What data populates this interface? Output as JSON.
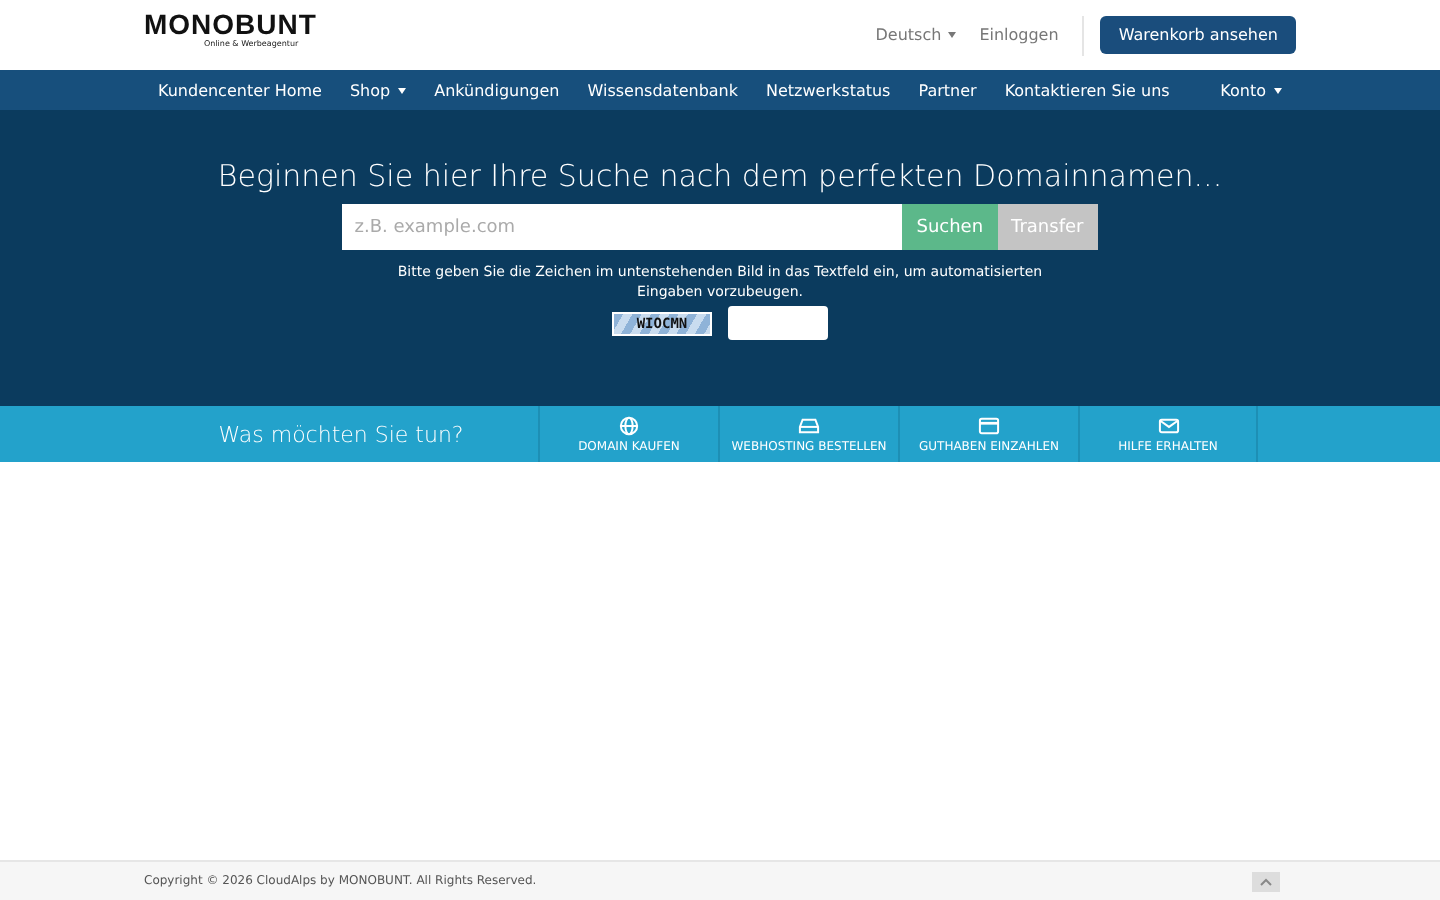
{
  "logo": {
    "name": "MONOBUNT",
    "tagline": "Online & Werbeagentur"
  },
  "top_links": [
    {
      "label": "Deutsch",
      "dropdown": true
    },
    {
      "label": "Einloggen",
      "dropdown": false
    }
  ],
  "cart_button": "Warenkorb ansehen",
  "nav": {
    "items": [
      {
        "label": "Kundencenter Home",
        "dropdown": false
      },
      {
        "label": "Shop",
        "dropdown": true
      },
      {
        "label": "Ankündigungen",
        "dropdown": false
      },
      {
        "label": "Wissensdatenbank",
        "dropdown": false
      },
      {
        "label": "Netzwerkstatus",
        "dropdown": false
      },
      {
        "label": "Partner",
        "dropdown": false
      },
      {
        "label": "Kontaktieren Sie uns",
        "dropdown": false
      }
    ],
    "account": {
      "label": "Konto",
      "dropdown": true
    }
  },
  "hero": {
    "title": "Beginnen Sie hier Ihre Suche nach dem perfekten Domainnamen...",
    "placeholder": "z.B. example.com",
    "search_button": "Suchen",
    "transfer_button": "Transfer",
    "captcha_hint": "Bitte geben Sie die Zeichen im untenstehenden Bild in das Textfeld ein, um automatisierten Eingaben vorzubeugen.",
    "captcha_code": "WIOCMN"
  },
  "actions": {
    "title": "Was möchten Sie tun?",
    "items": [
      {
        "kind": "globe",
        "label": "DOMAIN KAUFEN"
      },
      {
        "kind": "server",
        "label": "WEBHOSTING BESTELLEN"
      },
      {
        "kind": "card",
        "label": "GUTHABEN EINZAHLEN"
      },
      {
        "kind": "mail",
        "label": "HILFE ERHALTEN"
      }
    ]
  },
  "footer": {
    "copyright": "Copyright © 2026 CloudAlps by MONOBUNT. All Rights Reserved."
  }
}
